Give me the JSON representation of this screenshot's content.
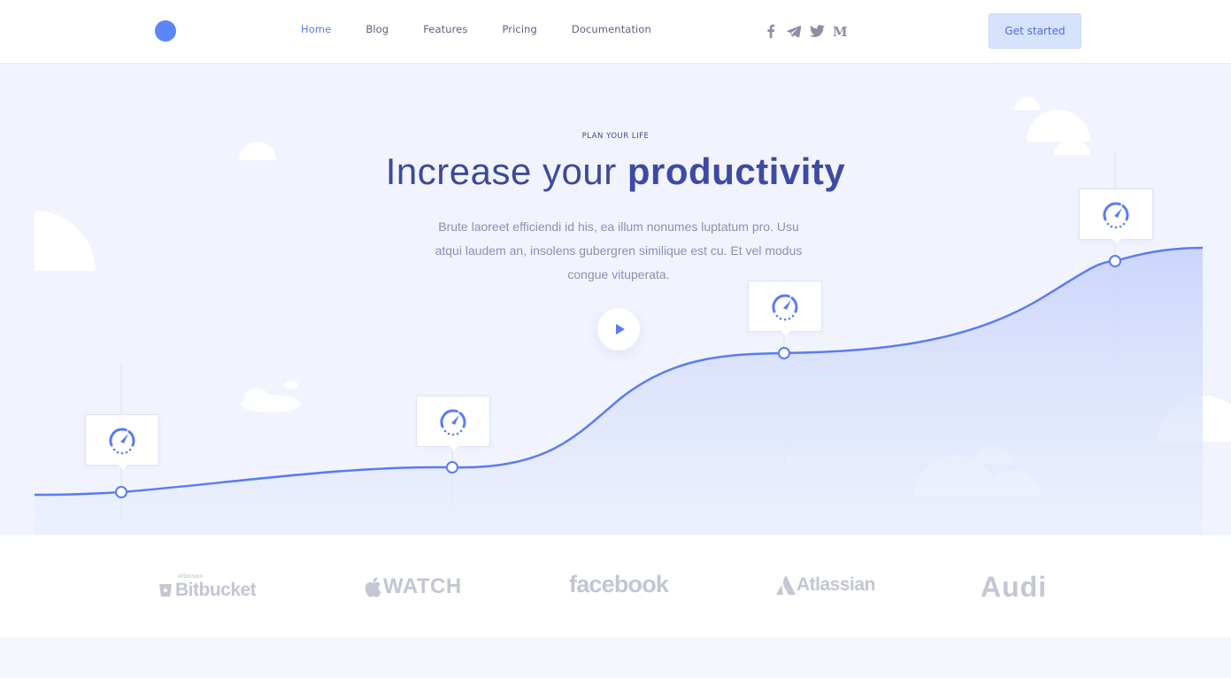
{
  "header": {
    "nav": [
      {
        "label": "Home",
        "active": true
      },
      {
        "label": "Blog",
        "active": false
      },
      {
        "label": "Features",
        "active": false
      },
      {
        "label": "Pricing",
        "active": false
      },
      {
        "label": "Documentation",
        "active": false
      }
    ],
    "social": [
      "facebook-icon",
      "telegram-icon",
      "twitter-icon",
      "medium-icon"
    ],
    "cta_label": "Get started"
  },
  "hero": {
    "eyebrow": "PLAN YOUR LIFE",
    "title_plain": "Increase your ",
    "title_bold": "productivity",
    "description": "Brute laoreet efficiendi id his, ea illum nonumes luptatum pro. Usu atqui laudem an, insolens gubergren similique est cu. Et vel modus congue vituperata."
  },
  "logos": {
    "bitbucket_small": "Atlassian",
    "bitbucket": "Bitbucket",
    "watch": "WATCH",
    "facebook": "facebook",
    "atlassian": "Atlassian",
    "audi": "Audi"
  },
  "colors": {
    "accent": "#5b7cf0",
    "brand_dot": "#5b86f7",
    "hero_bg": "#f1f4fe",
    "heading": "#3d4a96"
  }
}
